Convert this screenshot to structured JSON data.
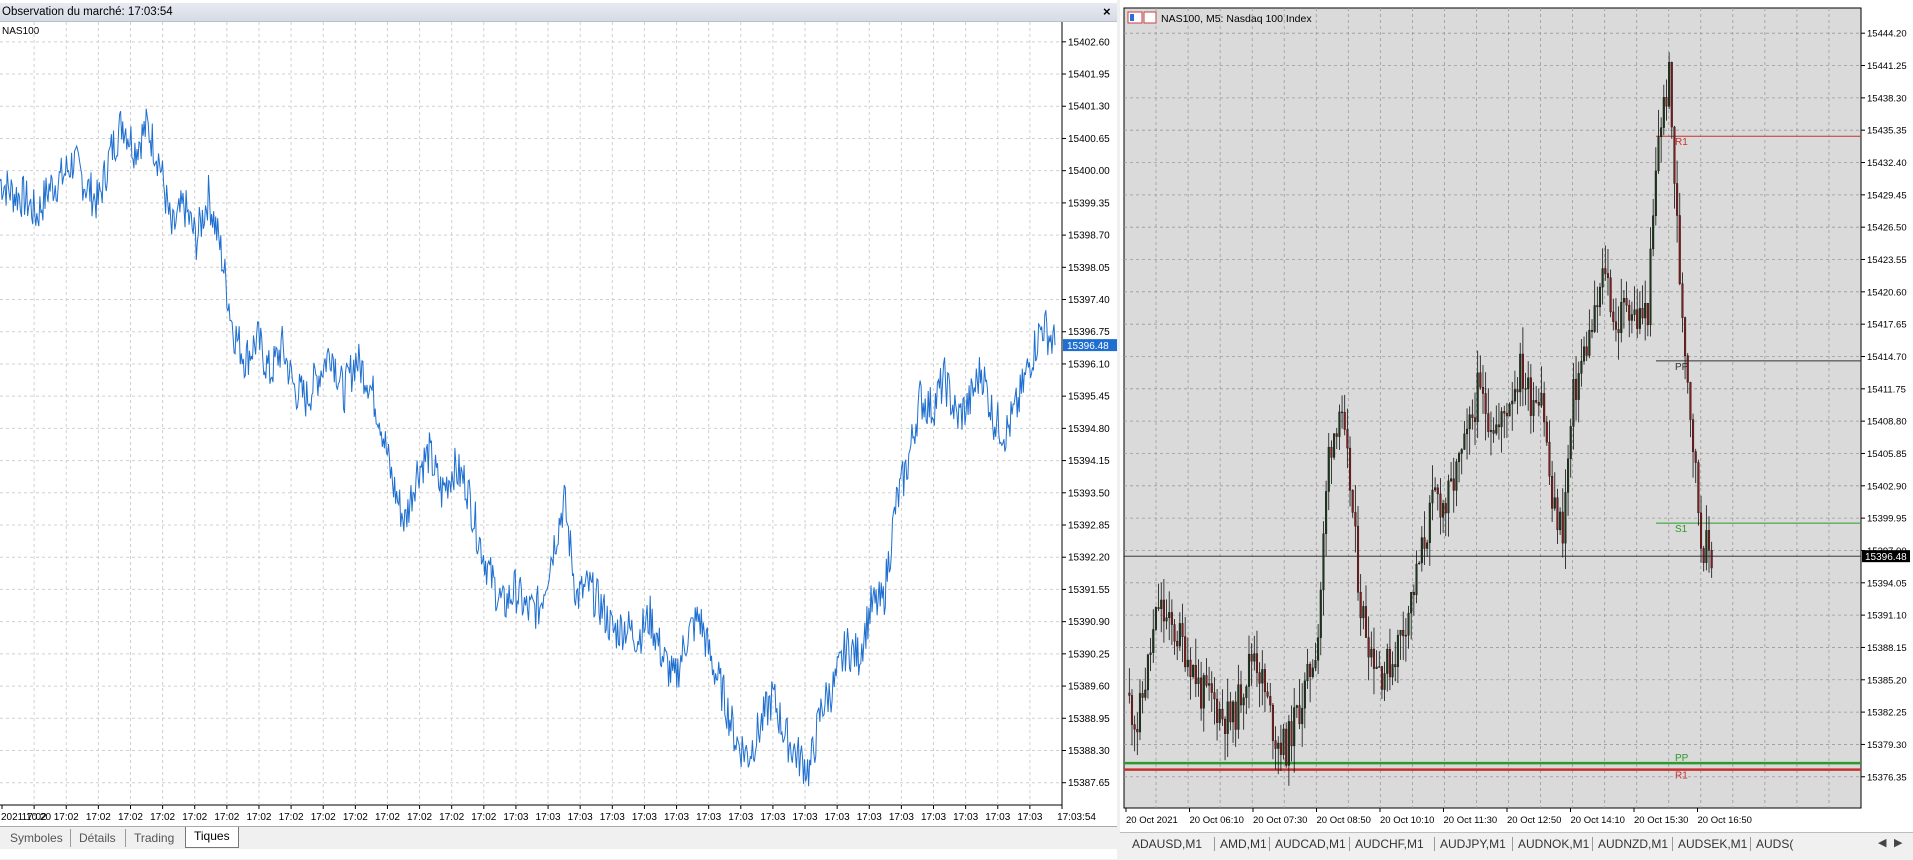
{
  "left": {
    "title": "Observation du marché: 17:03:54",
    "symbol": "NAS100",
    "y_labels": [
      "15402.60",
      "15401.95",
      "15401.30",
      "15400.65",
      "15400.00",
      "15399.35",
      "15398.70",
      "15398.05",
      "15397.40",
      "15396.75",
      "15396.10",
      "15395.45",
      "15394.80",
      "15394.15",
      "15393.50",
      "15392.85",
      "15392.20",
      "15391.55",
      "15390.90",
      "15390.25",
      "15389.60",
      "15388.95",
      "15388.30",
      "15387.65"
    ],
    "current_price": "15396.48",
    "x_labels": [
      "2021.10.20",
      "17:02",
      "17:02",
      "17:02",
      "17:02",
      "17:02",
      "17:02",
      "17:02",
      "17:02",
      "17:02",
      "17:02",
      "17:02",
      "17:02",
      "17:02",
      "17:02",
      "17:02",
      "17:03",
      "17:03",
      "17:03",
      "17:03",
      "17:03",
      "17:03",
      "17:03",
      "17:03",
      "17:03",
      "17:03",
      "17:03",
      "17:03",
      "17:03",
      "17:03",
      "17:03",
      "17:03",
      "17:03",
      "17:03:54"
    ],
    "tabs": [
      "Symboles",
      "Détails",
      "Trading",
      "Tiques"
    ],
    "active_tab": "Tiques",
    "line_color": "#1f6fd0",
    "chart_data": {
      "type": "line",
      "title": "",
      "series": [
        {
          "name": "NAS100",
          "values": [
            15399.8,
            15399.55,
            15399.45,
            15399.1,
            15399.65,
            15399.85,
            15400.2,
            15399.7,
            15399.35,
            15400.35,
            15401.0,
            15400.45,
            15400.9,
            15400.2,
            15398.75,
            15399.3,
            15398.6,
            15399.5,
            15398.4,
            15396.8,
            15396.2,
            15396.6,
            15395.9,
            15396.45,
            15395.6,
            15395.4,
            15395.9,
            15396.4,
            15395.5,
            15396.2,
            15395.8,
            15395.0,
            15393.7,
            15392.9,
            15393.95,
            15394.3,
            15393.5,
            15394.0,
            15393.7,
            15392.6,
            15391.8,
            15391.2,
            15391.55,
            15391.1,
            15391.2,
            15392.3,
            15393.35,
            15391.4,
            15391.6,
            15391.2,
            15390.7,
            15390.8,
            15390.6,
            15391.0,
            15390.2,
            15389.7,
            15390.6,
            15391.0,
            15390.1,
            15389.4,
            15388.5,
            15388.2,
            15388.8,
            15389.4,
            15388.6,
            15388.2,
            15387.9,
            15389.2,
            15389.6,
            15390.4,
            15390.2,
            15391.2,
            15391.3,
            15393.2,
            15394.1,
            15395.4,
            15395.2,
            15395.8,
            15395.0,
            15395.3,
            15396.0,
            15395.0,
            15394.7,
            15395.3,
            15396.2,
            15396.9,
            15396.48
          ],
          "color": "#1f6fd0"
        }
      ],
      "ylim": [
        15387.2,
        15403.0
      ],
      "grid": true
    }
  },
  "right": {
    "header": "NAS100, M5:  Nasdaq 100 Index",
    "y_labels": [
      "15444.20",
      "15441.25",
      "15438.30",
      "15435.35",
      "15432.40",
      "15429.45",
      "15426.50",
      "15423.55",
      "15420.60",
      "15417.65",
      "15414.70",
      "15411.75",
      "15408.80",
      "15405.85",
      "15402.90",
      "15399.95",
      "15397.00",
      "15394.05",
      "15391.10",
      "15388.15",
      "15385.20",
      "15382.25",
      "15379.30",
      "15376.35"
    ],
    "current_price": "15396.48",
    "x_labels": [
      "20 Oct 2021",
      "20 Oct 06:10",
      "20 Oct 07:30",
      "20 Oct 08:50",
      "20 Oct 10:10",
      "20 Oct 11:30",
      "20 Oct 12:50",
      "20 Oct 14:10",
      "20 Oct 15:30",
      "20 Oct 16:50"
    ],
    "levels": [
      {
        "label": "R1",
        "price": "15434.80",
        "color": "#c83232"
      },
      {
        "label": "PP",
        "price": "15414.30",
        "color": "#333333"
      },
      {
        "label": "S1",
        "price": "15399.50",
        "color": "#2a9a2a"
      },
      {
        "label": "PP",
        "price": "15377.60",
        "color": "#2a9a2a"
      },
      {
        "label": "R1",
        "price": "15377.00",
        "color": "#c83232"
      }
    ],
    "bull_color": "#1a3a1a",
    "bear_color": "#8b1a1a",
    "chart_data": {
      "type": "line",
      "title": "",
      "series": [
        {
          "name": "NAS100, M5",
          "values": [
            15384.0,
            15381.0,
            15386.5,
            15392.0,
            15390.0,
            15389.0,
            15387.0,
            15384.0,
            15383.5,
            15382.0,
            15381.5,
            15385.0,
            15388.0,
            15384.0,
            15380.0,
            15379.0,
            15382.0,
            15385.0,
            15389.5,
            15406.0,
            15410.0,
            15403.0,
            15392.0,
            15388.0,
            15386.0,
            15387.0,
            15390.0,
            15393.5,
            15398.0,
            15402.0,
            15401.0,
            15404.0,
            15407.0,
            15411.5,
            15409.5,
            15408.0,
            15411.0,
            15413.5,
            15411.0,
            15412.0,
            15401.0,
            15399.0,
            15411.0,
            15415.0,
            15418.0,
            15423.0,
            15417.0,
            15420.0,
            15418.0,
            15419.0,
            15435.0,
            15440.0,
            15422.0,
            15410.0,
            15398.0,
            15396.48
          ]
        }
      ],
      "ylim": [
        15373.5,
        15446.5
      ],
      "grid": true
    },
    "tabs": [
      "ADAUSD,M1",
      "AMD,M1",
      "AUDCAD,M1",
      "AUDCHF,M1",
      "AUDJPY,M1",
      "AUDNOK,M1",
      "AUDNZD,M1",
      "AUDSEK,M1",
      "AUDS("
    ]
  }
}
